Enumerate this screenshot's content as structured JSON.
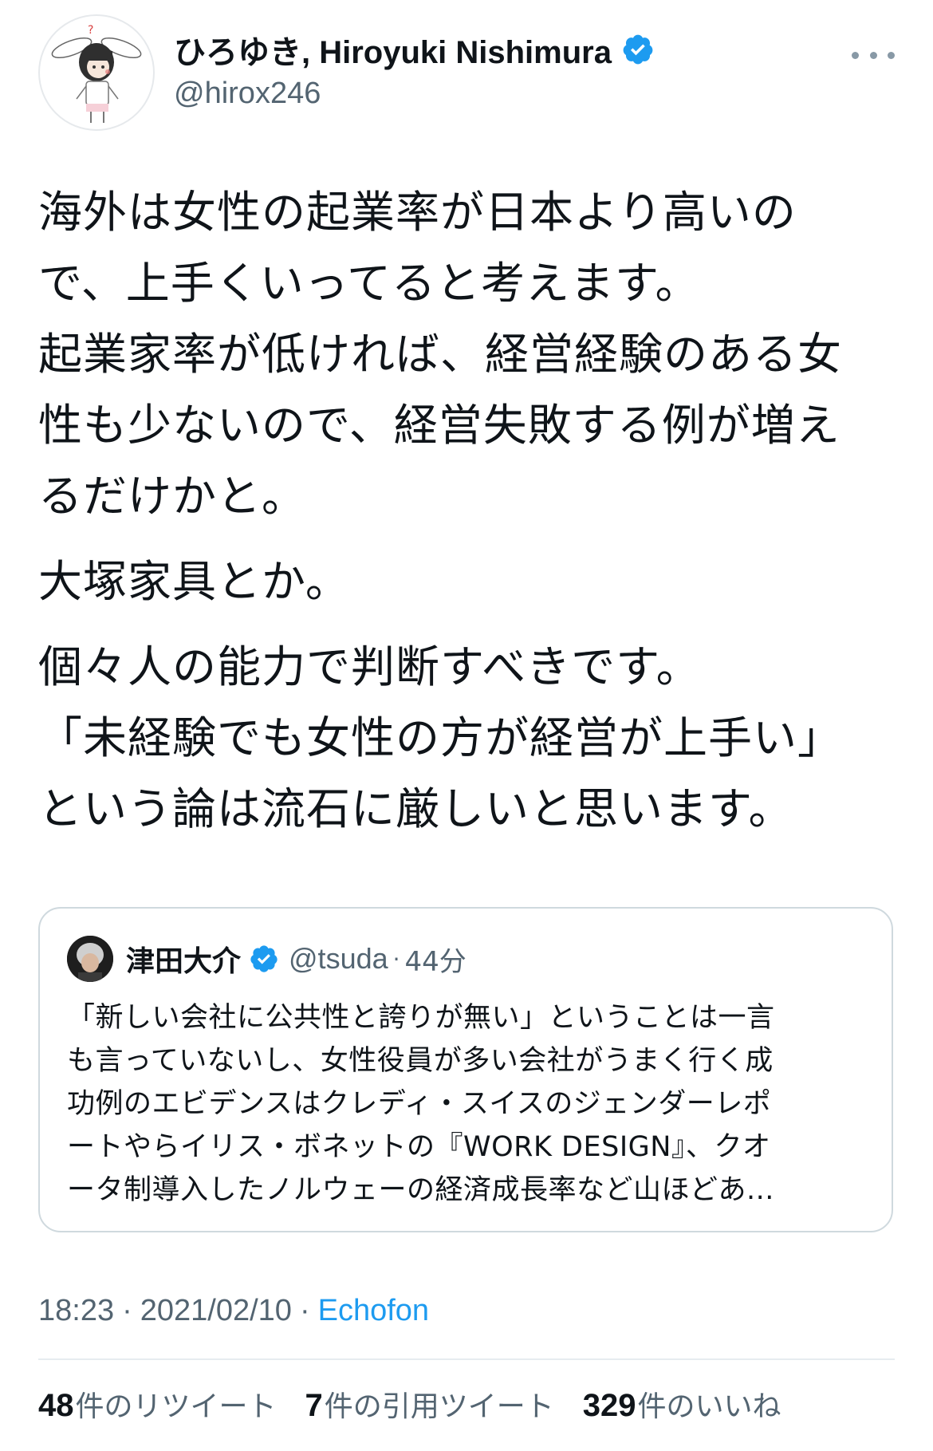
{
  "author": {
    "display_name": "ひろゆき, Hiroyuki Nishimura",
    "handle": "@hirox246",
    "avatar_icon": "avatar-cartoon-bunny",
    "verified_icon": "verified-badge-icon"
  },
  "more_icon": "more-dots-icon",
  "tweet": {
    "paragraphs": [
      {
        "lines": [
          "海外は女性の起業率が日本より高いの",
          "で、上手くいってると考えます。",
          "起業家率が低ければ、経営経験のある女",
          "性も少ないので、経営失敗する例が増え",
          "るだけかと。"
        ]
      },
      {
        "lines": [
          "大塚家具とか。"
        ]
      },
      {
        "lines": [
          "個々人の能力で判断すべきです。",
          "「未経験でも女性の方が経営が上手い」",
          "という論は流石に厳しいと思います。"
        ]
      }
    ]
  },
  "quote": {
    "name": "津田大介",
    "handle": "@tsuda",
    "separator": "·",
    "time": "44分",
    "lines": [
      "「新しい会社に公共性と誇りが無い」ということは一言",
      "も言っていないし、女性役員が多い会社がうまく行く成",
      "功例のエビデンスはクレディ・スイスのジェンダーレポ",
      "ートやらイリス・ボネットの『WORK DESIGN』、クオ",
      "ータ制導入したノルウェーの経済成長率など山ほどあ..."
    ]
  },
  "meta": {
    "time": "18:23",
    "separator": "·",
    "date": "2021/02/10",
    "source": "Echofon"
  },
  "stats": [
    {
      "count": "48",
      "label": "件のリツイート"
    },
    {
      "count": "7",
      "label": "件の引用ツイート"
    },
    {
      "count": "329",
      "label": "件のいいね"
    }
  ],
  "colors": {
    "accent": "#1d9bf0",
    "verified": "#1d9bf0",
    "text": "#0f1419",
    "muted": "#536471",
    "border": "#cfd9de"
  }
}
